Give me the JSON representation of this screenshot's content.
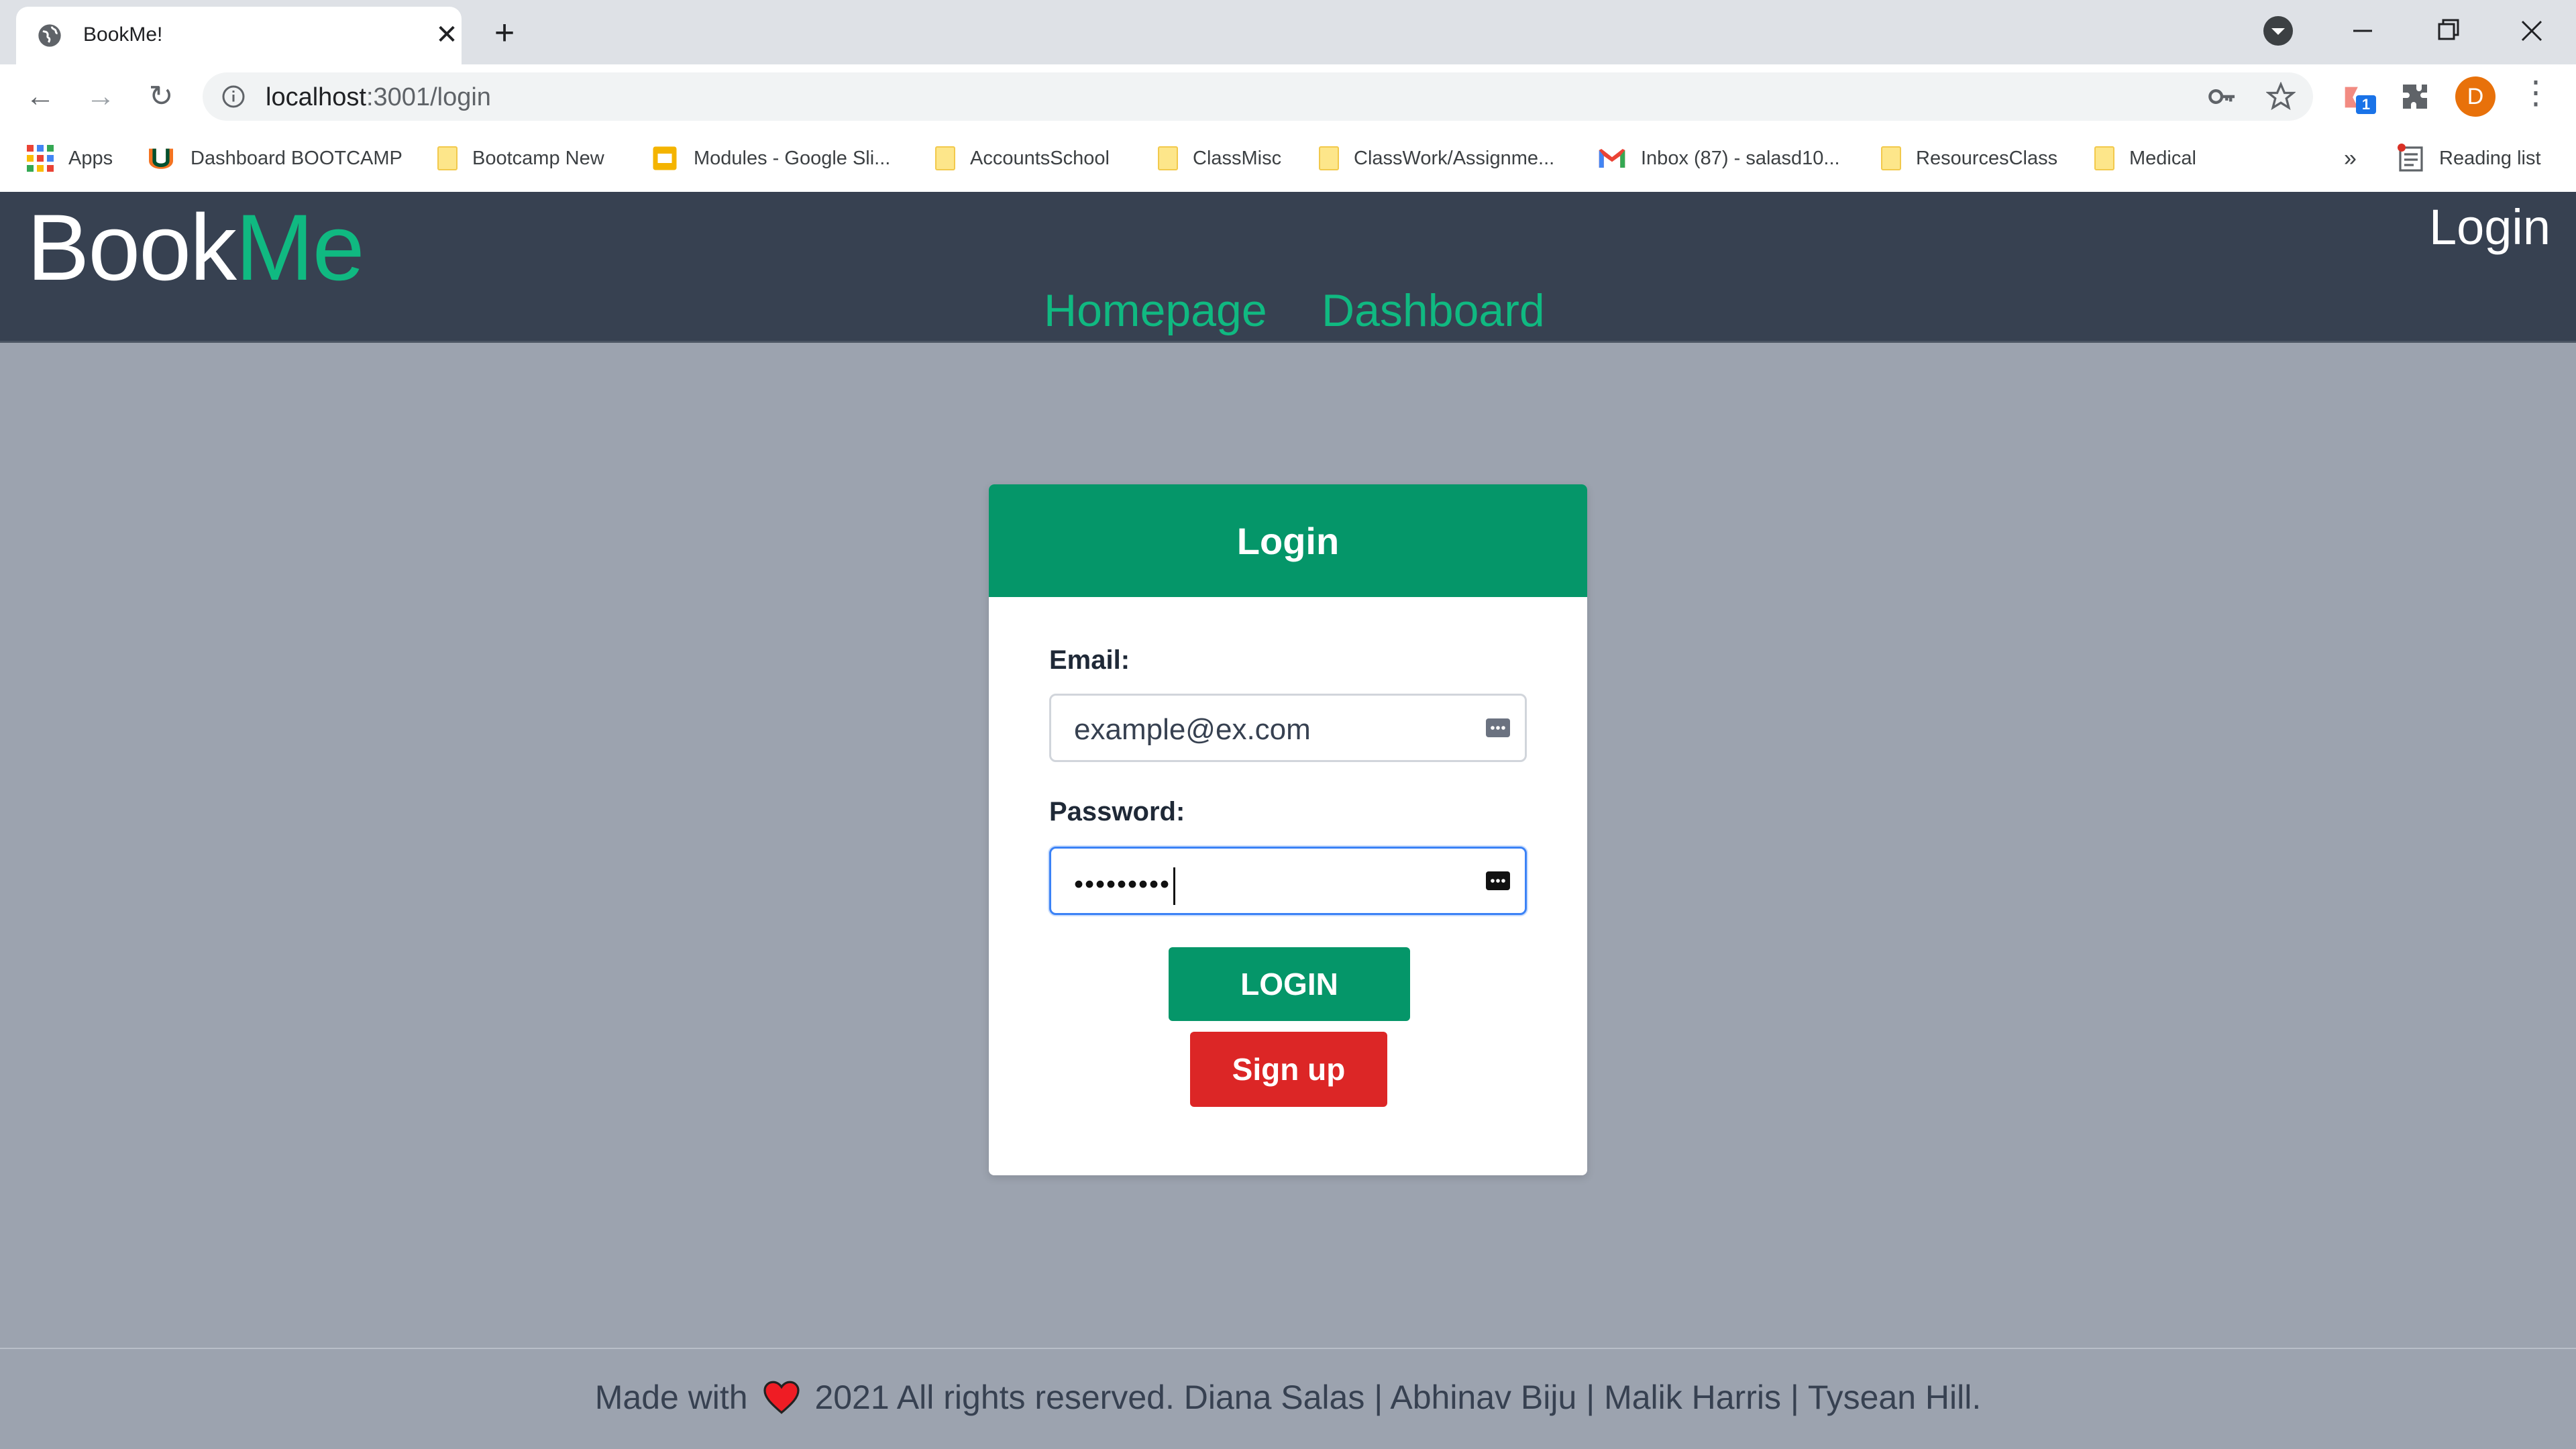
{
  "browser": {
    "tab_title": "BookMe!",
    "tab_close": "✕",
    "new_tab": "+",
    "url_host": "localhost",
    "url_rest": ":3001/login",
    "profile_initial": "D",
    "extension_badge": "1",
    "bookmarks": [
      {
        "label": "Apps",
        "icon": "apps-grid-icon"
      },
      {
        "label": "Dashboard BOOTCAMP",
        "icon": "u-logo-icon"
      },
      {
        "label": "Bootcamp New",
        "icon": "folder-icon"
      },
      {
        "label": "Modules - Google Sli...",
        "icon": "slides-icon"
      },
      {
        "label": "AccountsSchool",
        "icon": "folder-icon"
      },
      {
        "label": "ClassMisc",
        "icon": "folder-icon"
      },
      {
        "label": "ClassWork/Assignme...",
        "icon": "folder-icon"
      },
      {
        "label": "Inbox (87) - salasd10...",
        "icon": "gmail-icon"
      },
      {
        "label": "ResourcesClass",
        "icon": "folder-icon"
      },
      {
        "label": "Medical",
        "icon": "folder-icon"
      }
    ],
    "more_bookmarks": "»",
    "reading_list": "Reading list"
  },
  "app": {
    "logo_book": "Book",
    "logo_me": "Me",
    "header_login": "Login",
    "nav": {
      "homepage": "Homepage",
      "dashboard": "Dashboard"
    },
    "form": {
      "title": "Login",
      "email_label": "Email:",
      "email_value": "example@ex.com",
      "password_label": "Password:",
      "password_value": "•••••••••",
      "login_button": "LOGIN",
      "signup_button": "Sign up"
    },
    "footer": {
      "made_with": "Made with",
      "rest": "2021 All rights reserved. Diana Salas | Abhinav Biju | Malik Harris | Tysean Hill."
    }
  },
  "colors": {
    "header_bg": "#374151",
    "accent_green": "#10b981",
    "card_header": "#059669",
    "signup_red": "#dc2626",
    "page_bg": "#9ca3af"
  }
}
